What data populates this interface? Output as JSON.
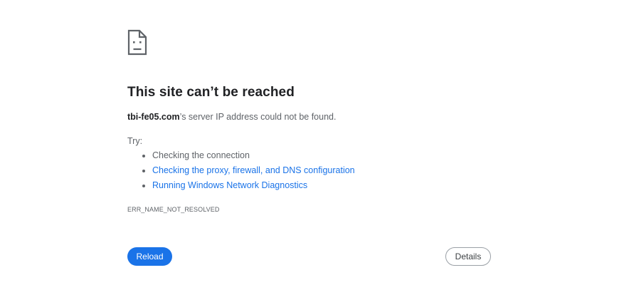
{
  "error_page": {
    "icon": "sad-document-icon",
    "title": "This site can’t be reached",
    "summary_domain": "tbi-fe05.com",
    "summary_rest": "’s server IP address could not be found.",
    "try_label": "Try:",
    "suggestions": [
      "Checking the connection",
      "Checking the proxy, firewall, and DNS configuration",
      "Running Windows Network Diagnostics"
    ],
    "error_code": "ERR_NAME_NOT_RESOLVED",
    "reload_label": "Reload",
    "details_label": "Details"
  },
  "colors": {
    "accent": "#1a73e8",
    "text_primary": "#202124",
    "text_secondary": "#5f6368"
  }
}
